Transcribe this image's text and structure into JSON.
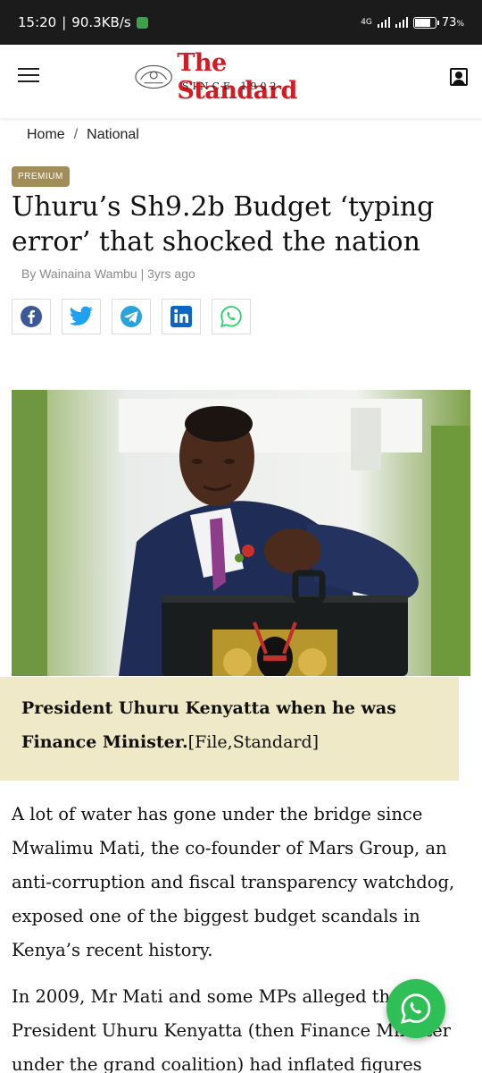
{
  "status_bar": {
    "time": "15:20",
    "network_speed": "90.3KB/s",
    "network_type": "4G",
    "battery_level": "73",
    "battery_percent_sign": "%"
  },
  "header": {
    "brand_name": "The Standard",
    "brand_tagline": "SINCE 1902",
    "menu_icon": "hamburger-menu-icon",
    "account_icon": "user-account-icon"
  },
  "breadcrumb": {
    "items": [
      "Home",
      "National"
    ],
    "separator": "/"
  },
  "article": {
    "badge": "PREMIUM",
    "headline": "Uhuru’s Sh9.2b Budget ‘typing error’ that shocked the nation",
    "byline": "By Wainaina Wambu | 3yrs ago",
    "share_icons": [
      "facebook-icon",
      "twitter-icon",
      "telegram-icon",
      "linkedin-icon",
      "whatsapp-icon"
    ],
    "image_caption": "President Uhuru Kenyatta when he was Finance Minister.",
    "image_credit": "[File,Standard]",
    "paragraphs": [
      "A lot of water has gone under the bridge since Mwalimu Mati, the co-founder of Mars Group, an anti-corruption and fiscal transparency watchdog, exposed one of the biggest budget scandals in Kenya’s recent history.",
      "In 2009, Mr Mati and some MPs alleged that President Uhuru Kenyatta (then Finance Minister under the grand coalition) had inflated figures"
    ]
  },
  "colors": {
    "brand_red": "#d31b23",
    "premium_badge": "#a08d5a",
    "caption_background": "#f0e9c8",
    "facebook": "#3b5998",
    "twitter": "#1da1f2",
    "telegram": "#2aa3dd",
    "linkedin": "#0a66c2",
    "whatsapp": "#25d366"
  },
  "fab": {
    "icon": "whatsapp-icon"
  }
}
